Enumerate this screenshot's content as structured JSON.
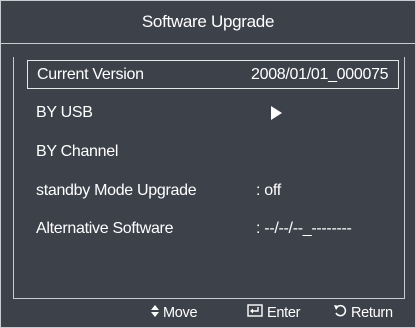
{
  "window": {
    "title": "Software Upgrade"
  },
  "menu": {
    "items": [
      {
        "label": "Current Version",
        "value": "2008/01/01_000075",
        "selected": true
      },
      {
        "label": "BY USB",
        "value_icon": "play-arrow-icon"
      },
      {
        "label": "BY Channel"
      },
      {
        "label": "standby Mode Upgrade",
        "value": ":  off"
      },
      {
        "label": "Alternative Software",
        "value": ":  --/--/--_--------"
      }
    ]
  },
  "footer": {
    "move_label": "Move",
    "move_icon": "up-down-arrow-icon",
    "enter_label": "Enter",
    "enter_icon": "enter-icon",
    "return_label": "Return",
    "return_icon": "return-arrow-icon"
  },
  "colors": {
    "background": "#3d414a",
    "border": "#c8ccd2",
    "text": "#ffffff"
  }
}
